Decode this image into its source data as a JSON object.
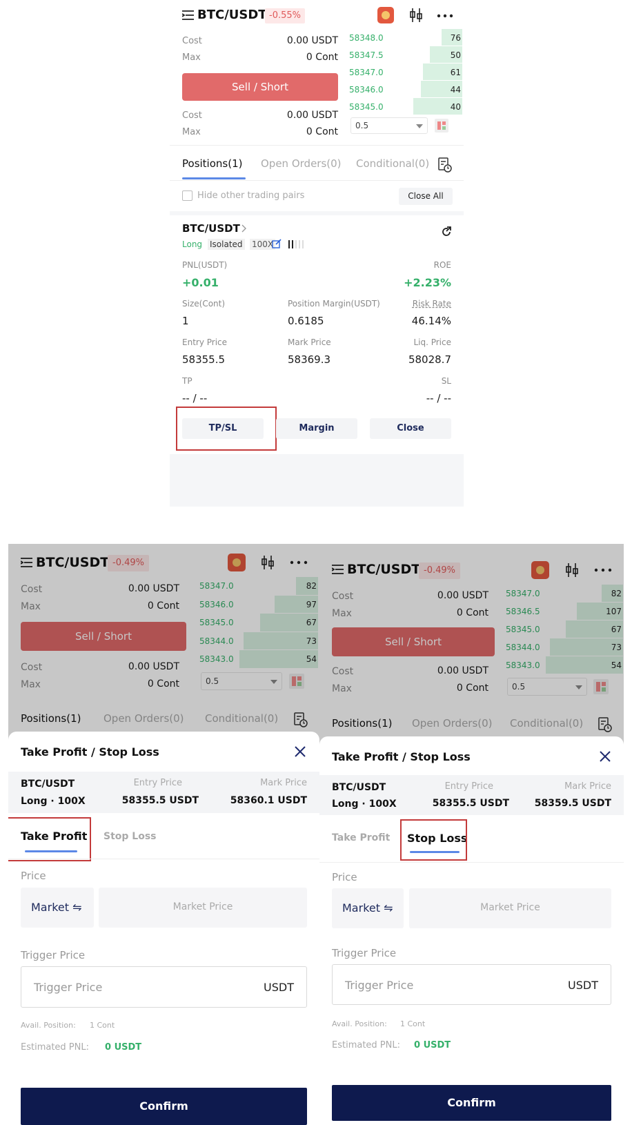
{
  "top": {
    "pair": "BTC/USDT",
    "change": "-0.55%",
    "order_panel": {
      "cost_label": "Cost",
      "cost_value": "0.00",
      "cost_unit": "USDT",
      "max_label": "Max",
      "max_value": "0",
      "max_unit": "Cont",
      "sell_label": "Sell / Short",
      "cost2_value": "0.00",
      "max2_value": "0"
    },
    "orderbook": {
      "rows": [
        {
          "price": "58348.0",
          "qty": "76",
          "depth": 0.28
        },
        {
          "price": "58347.5",
          "qty": "50",
          "depth": 0.44
        },
        {
          "price": "58347.0",
          "qty": "61",
          "depth": 0.54
        },
        {
          "price": "58346.0",
          "qty": "44",
          "depth": 0.57
        },
        {
          "price": "58345.0",
          "qty": "40",
          "depth": 0.67
        }
      ],
      "precision": "0.5"
    },
    "tabs": [
      "Positions(1)",
      "Open Orders(0)",
      "Conditional(0)"
    ],
    "hide_pairs_label": "Hide other trading pairs",
    "close_all_label": "Close All",
    "position": {
      "pair": "BTC/USDT",
      "side": "Long",
      "mode": "Isolated",
      "leverage": "100X",
      "pnl_label": "PNL(USDT)",
      "pnl_value": "+0.01",
      "roe_label": "ROE",
      "roe_value": "+2.23%",
      "size_label": "Size(Cont)",
      "size_value": "1",
      "margin_label": "Position Margin(USDT)",
      "margin_value": "0.6185",
      "risk_label": "Risk Rate",
      "risk_value": "46.14%",
      "entry_label": "Entry Price",
      "entry_value": "58355.5",
      "mark_label": "Mark Price",
      "mark_value": "58369.3",
      "liq_label": "Liq. Price",
      "liq_value": "58028.7",
      "tp_label": "TP",
      "tp_value": "-- / --",
      "sl_label": "SL",
      "sl_value": "-- / --",
      "btn_tpsl": "TP/SL",
      "btn_margin": "Margin",
      "btn_close": "Close"
    }
  },
  "left": {
    "pair": "BTC/USDT",
    "change": "-0.49%",
    "cost_label": "Cost",
    "cost_value": "0.00",
    "cost_unit": "USDT",
    "max_label": "Max",
    "max_value": "0",
    "max_unit": "Cont",
    "sell_label": "Sell / Short",
    "orderbook": {
      "rows": [
        {
          "price": "58347.0",
          "qty": "82",
          "depth": 0.28
        },
        {
          "price": "58346.0",
          "qty": "97",
          "depth": 0.55
        },
        {
          "price": "58345.0",
          "qty": "67",
          "depth": 0.74
        },
        {
          "price": "58344.0",
          "qty": "73",
          "depth": 0.95
        },
        {
          "price": "58343.0",
          "qty": "54",
          "depth": 1.0
        }
      ],
      "precision": "0.5"
    },
    "tabs": [
      "Positions(1)",
      "Open Orders(0)",
      "Conditional(0)"
    ],
    "sheet": {
      "title": "Take Profit / Stop Loss",
      "pair": "BTC/USDT",
      "side": "Long · 100X",
      "entry_label": "Entry Price",
      "entry_value": "58355.5 USDT",
      "mark_label": "Mark Price",
      "mark_value": "58360.1 USDT",
      "tab_tp": "Take Profit",
      "tab_sl": "Stop Loss",
      "price_label": "Price",
      "market_label": "Market ⇋",
      "market_placeholder": "Market Price",
      "trigger_label": "Trigger Price",
      "trigger_placeholder": "Trigger Price",
      "trigger_unit": "USDT",
      "avail_label": "Avail. Position:",
      "avail_value": "1 Cont",
      "pnl_label": "Estimated PNL:",
      "pnl_value": "0 USDT",
      "confirm": "Confirm"
    }
  },
  "right": {
    "pair": "BTC/USDT",
    "change": "-0.49%",
    "cost_label": "Cost",
    "cost_value": "0.00",
    "cost_unit": "USDT",
    "max_label": "Max",
    "max_value": "0",
    "max_unit": "Cont",
    "sell_label": "Sell / Short",
    "orderbook": {
      "rows": [
        {
          "price": "58347.0",
          "qty": "82",
          "depth": 0.28
        },
        {
          "price": "58346.5",
          "qty": "107",
          "depth": 0.6
        },
        {
          "price": "58345.0",
          "qty": "67",
          "depth": 0.74
        },
        {
          "price": "58344.0",
          "qty": "73",
          "depth": 0.95
        },
        {
          "price": "58343.0",
          "qty": "54",
          "depth": 1.0
        }
      ],
      "precision": "0.5"
    },
    "tabs": [
      "Positions(1)",
      "Open Orders(0)",
      "Conditional(0)"
    ],
    "sheet": {
      "title": "Take Profit / Stop Loss",
      "pair": "BTC/USDT",
      "side": "Long · 100X",
      "entry_label": "Entry Price",
      "entry_value": "58355.5 USDT",
      "mark_label": "Mark Price",
      "mark_value": "58359.5 USDT",
      "tab_tp": "Take Profit",
      "tab_sl": "Stop Loss",
      "price_label": "Price",
      "market_label": "Market ⇋",
      "market_placeholder": "Market Price",
      "trigger_label": "Trigger Price",
      "trigger_placeholder": "Trigger Price",
      "trigger_unit": "USDT",
      "avail_label": "Avail. Position:",
      "avail_value": "1 Cont",
      "pnl_label": "Estimated PNL:",
      "pnl_value": "0 USDT",
      "confirm": "Confirm"
    }
  }
}
